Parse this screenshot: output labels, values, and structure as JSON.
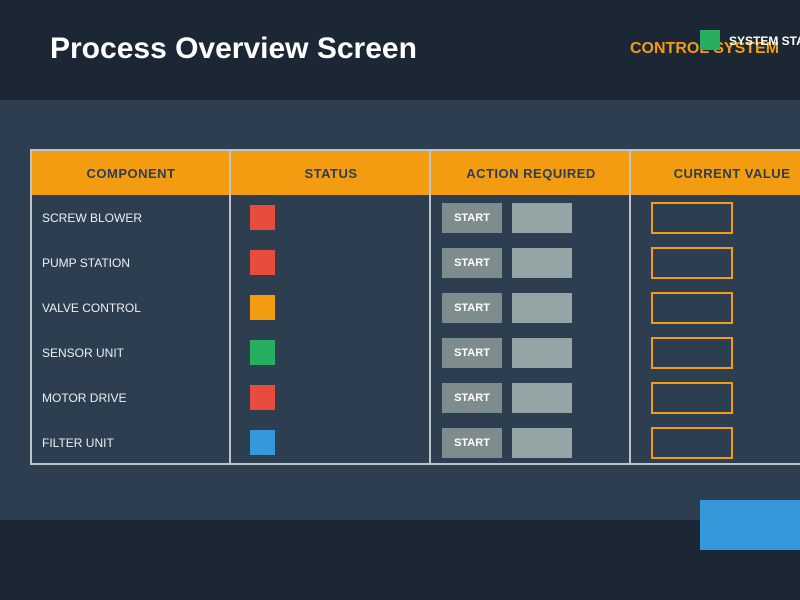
{
  "colors": {
    "header_bg": "#1b2735",
    "main_bg": "#2c3e50",
    "accent": "#f39c12",
    "table_border": "#bdc3c7",
    "status_red": "#e74c3c",
    "status_orange": "#f39c12",
    "status_green": "#27ae60",
    "status_blue": "#3498db",
    "button_gray": "#7f8c8d",
    "field_gray": "#95a5a6",
    "footer_button": "#3498db"
  },
  "header": {
    "title": "Process Overview Screen",
    "subtitle": "CONTROL SYSTEM",
    "system_status_label": "SYSTEM STATUS",
    "system_status_color": "#27ae60"
  },
  "table": {
    "columns": [
      "COMPONENT",
      "STATUS",
      "ACTION REQUIRED",
      "CURRENT VALUE"
    ],
    "rows": [
      {
        "component": "SCREW BLOWER",
        "status_color": "#e74c3c",
        "action_label": "START",
        "action_value": "",
        "current_value": ""
      },
      {
        "component": "PUMP STATION",
        "status_color": "#e74c3c",
        "action_label": "START",
        "action_value": "",
        "current_value": ""
      },
      {
        "component": "VALVE CONTROL",
        "status_color": "#f39c12",
        "action_label": "START",
        "action_value": "",
        "current_value": ""
      },
      {
        "component": "SENSOR UNIT",
        "status_color": "#27ae60",
        "action_label": "START",
        "action_value": "",
        "current_value": ""
      },
      {
        "component": "MOTOR DRIVE",
        "status_color": "#e74c3c",
        "action_label": "START",
        "action_value": "",
        "current_value": ""
      },
      {
        "component": "FILTER UNIT",
        "status_color": "#3498db",
        "action_label": "START",
        "action_value": "",
        "current_value": ""
      }
    ]
  }
}
